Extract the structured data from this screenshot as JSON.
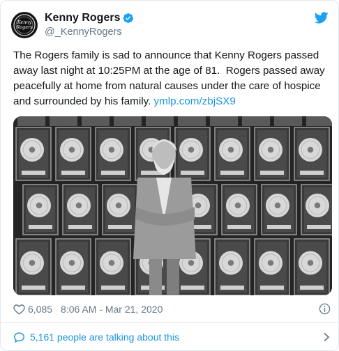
{
  "author": {
    "display_name": "Kenny Rogers",
    "handle": "@_KennyRogers",
    "avatar_text": "Kenny Rogers"
  },
  "tweet": {
    "text": "The Rogers family is sad to announce that Kenny Rogers passed away last night at 10:25PM at the age of 81.  Rogers passed away peacefully at home from natural causes under the care of hospice and surrounded by his family. ",
    "link_text": "ymlp.com/zbjSX9"
  },
  "stats": {
    "likes": "6,085",
    "timestamp": "8:06 AM - Mar 21, 2020"
  },
  "footer": {
    "conversation_text": "5,161 people are talking about this"
  },
  "icons": {
    "verified": "verified-badge-icon",
    "bird": "twitter-bird-icon",
    "heart": "heart-icon",
    "info": "info-icon",
    "bubble": "comment-bubble-icon",
    "chevron": "chevron-right-icon"
  },
  "colors": {
    "link": "#1b95e0",
    "secondary_text": "#657786",
    "border": "#e1e8ed",
    "verified": "#1da1f2"
  }
}
